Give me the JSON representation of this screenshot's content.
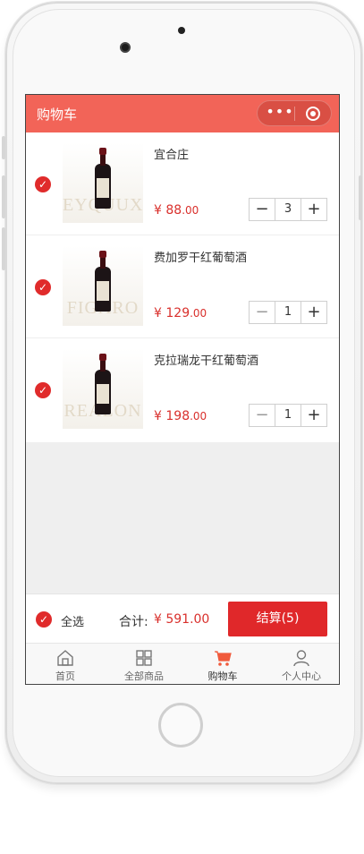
{
  "nav": {
    "title": "购物车",
    "capsule_more": "•••"
  },
  "cart": {
    "items": [
      {
        "name": "宜合庄",
        "price_symbol": "¥",
        "price_int": "88",
        "price_dec": ".00",
        "quantity": "3",
        "watermark": "EYQUUX"
      },
      {
        "name": "费加罗干红葡萄酒",
        "price_symbol": "¥",
        "price_int": "129",
        "price_dec": ".00",
        "quantity": "1",
        "watermark": "FIGARO"
      },
      {
        "name": "克拉瑞龙干红葡萄酒",
        "price_symbol": "¥",
        "price_int": "198",
        "price_dec": ".00",
        "quantity": "1",
        "watermark": "REALON"
      }
    ],
    "minus": "−",
    "plus": "+",
    "check_mark": "✓"
  },
  "summary": {
    "select_all_label": "全选",
    "total_label": "合计:",
    "total_value": "¥ 591.00",
    "checkout_label": "结算(5)"
  },
  "tabbar": [
    {
      "label": "首页",
      "icon": "home-icon"
    },
    {
      "label": "全部商品",
      "icon": "grid-icon"
    },
    {
      "label": "购物车",
      "icon": "cart-icon",
      "active": true
    },
    {
      "label": "个人中心",
      "icon": "user-icon"
    }
  ],
  "colors": {
    "header": "#f26458",
    "accent": "#e0282a",
    "price": "#d9302c"
  }
}
